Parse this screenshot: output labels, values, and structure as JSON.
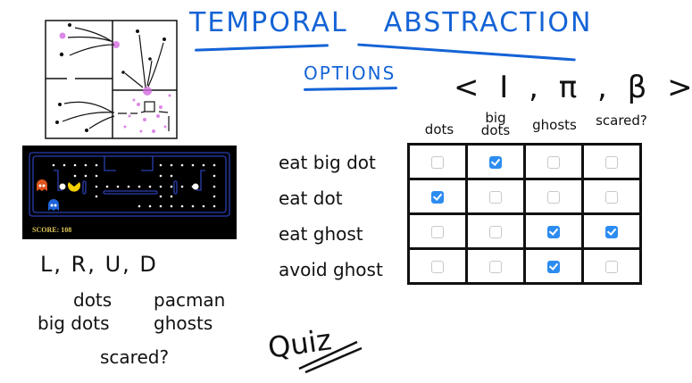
{
  "title": {
    "word1": "TEMPORAL",
    "word2": "ABSTRACTION"
  },
  "options_label": "OPTIONS",
  "tuple": "< I , π , β >",
  "columns": [
    "dots",
    "big dots",
    "ghosts",
    "scared?"
  ],
  "rows": [
    {
      "label": "eat big dot",
      "checks": [
        false,
        true,
        false,
        false
      ]
    },
    {
      "label": "eat dot",
      "checks": [
        true,
        false,
        false,
        false
      ]
    },
    {
      "label": "eat ghost",
      "checks": [
        false,
        false,
        true,
        true
      ]
    },
    {
      "label": "avoid ghost",
      "checks": [
        false,
        false,
        true,
        false
      ]
    }
  ],
  "actions": "L, R, U, D",
  "features": {
    "dots": "dots",
    "pacman": "pacman",
    "big_dots": "big dots",
    "ghosts": "ghosts",
    "scared": "scared?"
  },
  "quiz_label": "Quiz",
  "game": {
    "score_text": "SCORE: 108"
  },
  "colors": {
    "accent": "#1463d6",
    "checkbox_on": "#2d8cf0",
    "wall": "#2a3fb0",
    "pacman": "#f5d000"
  }
}
